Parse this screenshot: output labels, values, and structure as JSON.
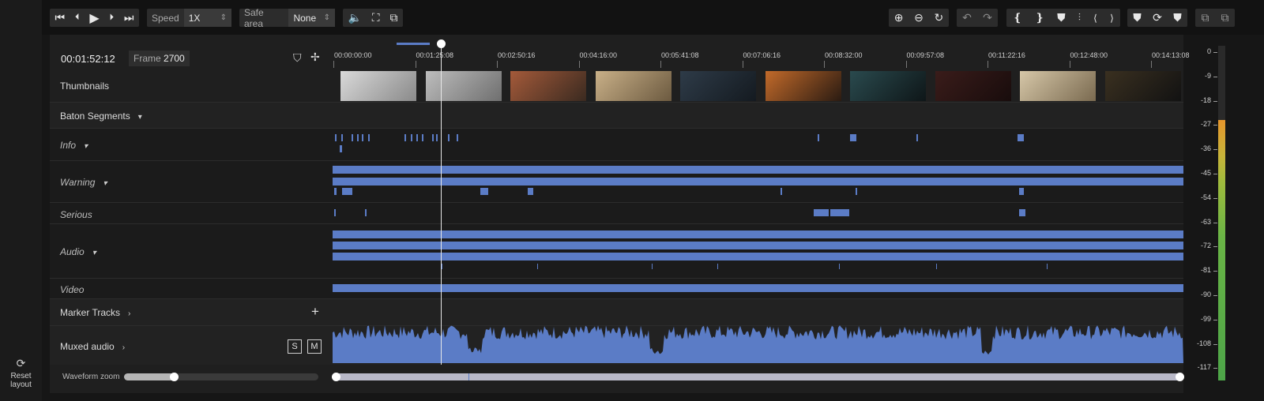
{
  "sidebar": {
    "reset_layout": "Reset\nlayout"
  },
  "toolbar": {
    "speed_label": "Speed",
    "speed_value": "1X",
    "safe_area_label": "Safe area",
    "safe_area_value": "None"
  },
  "timecode": {
    "current": "00:01:52:12",
    "frame_label": "Frame",
    "frame_value": "2700"
  },
  "ruler": {
    "labels": [
      "00:00:00:00",
      "00:01:25:08",
      "00:02:50:16",
      "00:04:16:00",
      "00:05:41:08",
      "00:07:06:16",
      "00:08:32:00",
      "00:09:57:08",
      "00:11:22:16",
      "00:12:48:00",
      "00:14:13:08"
    ]
  },
  "tracks": {
    "thumbnails": "Thumbnails",
    "baton_segments": "Baton Segments",
    "info": "Info",
    "warning": "Warning",
    "serious": "Serious",
    "audio": "Audio",
    "video": "Video",
    "marker_tracks": "Marker Tracks",
    "muxed_audio": "Muxed audio",
    "solo": "S",
    "mute": "M"
  },
  "footer": {
    "waveform_zoom": "Waveform zoom"
  },
  "meter": {
    "labels": [
      "0",
      "-9",
      "-18",
      "-27",
      "-36",
      "-45",
      "-54",
      "-63",
      "-72",
      "-81",
      "-90",
      "-99",
      "-108",
      "-117"
    ]
  },
  "thumbnails": [
    {
      "c1": "#d9d9d9",
      "c2": "#8a8a8a"
    },
    {
      "c1": "#bdbdbd",
      "c2": "#6f6f6f"
    },
    {
      "c1": "#a45a3a",
      "c2": "#3a2a20"
    },
    {
      "c1": "#c9b088",
      "c2": "#6c5a40"
    },
    {
      "c1": "#2e3b48",
      "c2": "#141a20"
    },
    {
      "c1": "#c26a2a",
      "c2": "#2a1b12"
    },
    {
      "c1": "#2a4a4e",
      "c2": "#0e1618"
    },
    {
      "c1": "#3a1c1a",
      "c2": "#180c0c"
    },
    {
      "c1": "#d6c7a8",
      "c2": "#7a6a50"
    },
    {
      "c1": "#3a3020",
      "c2": "#121212"
    }
  ],
  "colors": {
    "accent": "#5b7cc6",
    "panel": "#1f1f1f",
    "background": "#161616"
  }
}
